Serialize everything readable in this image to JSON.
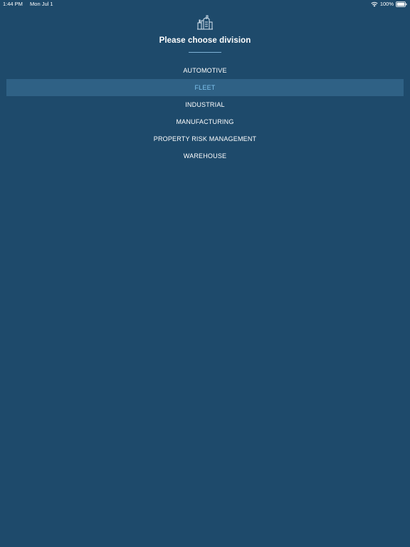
{
  "status_bar": {
    "time": "1:44 PM",
    "date": "Mon Jul 1",
    "battery": "100%",
    "wifi_icon": "wifi-icon",
    "battery_icon": "battery-full-icon"
  },
  "header": {
    "icon": "factory-icon",
    "title": "Please choose division"
  },
  "divisions": [
    {
      "label": "AUTOMOTIVE",
      "selected": false
    },
    {
      "label": "FLEET",
      "selected": true
    },
    {
      "label": "INDUSTRIAL",
      "selected": false
    },
    {
      "label": "MANUFACTURING",
      "selected": false
    },
    {
      "label": "PROPERTY RISK MANAGEMENT",
      "selected": false
    },
    {
      "label": "WAREHOUSE",
      "selected": false
    }
  ],
  "colors": {
    "background": "#1e4a6b",
    "selected_row": "#2f6185",
    "selected_text": "#7fc3ee",
    "accent_line": "#7fb2d6"
  }
}
